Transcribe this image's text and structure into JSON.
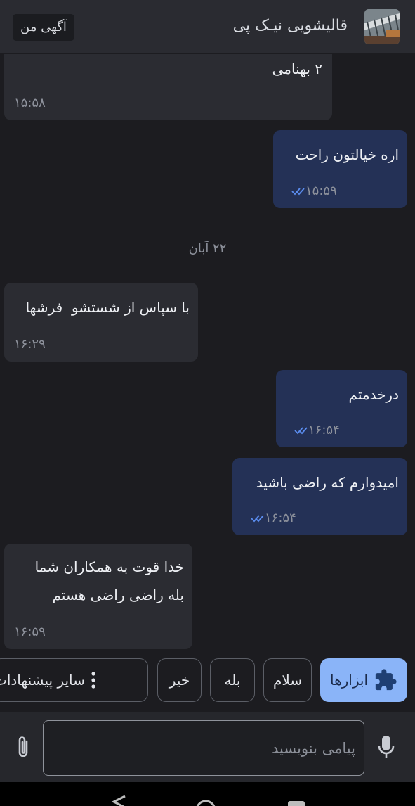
{
  "header": {
    "title": "قالیشویی نیـک پی",
    "my_ad_button": "آگهی من",
    "avatar_icon": "business-photo"
  },
  "messages": [
    {
      "direction": "in",
      "text": "۲ بهنامی",
      "time": "۱۵:۵۸"
    },
    {
      "direction": "out",
      "text": "اره خیالتون راحت",
      "time": "۱۵:۵۹",
      "status": "read"
    },
    {
      "direction": "in",
      "text": "با سپاس از شستشو  فرشها",
      "time": "۱۶:۲۹"
    },
    {
      "direction": "out",
      "text": "درخدمتم",
      "time": "۱۶:۵۴",
      "status": "read"
    },
    {
      "direction": "out",
      "text": "امیدوارم که راضی باشید",
      "time": "۱۶:۵۴",
      "status": "read"
    },
    {
      "direction": "in",
      "lines": [
        "خدا قوت به همکاران شما",
        "بله راضی راضی هستم"
      ],
      "time": "۱۶:۵۹"
    }
  ],
  "date_separator": "۲۲ آبان",
  "suggestions": {
    "tools": "ابزارها",
    "items": [
      "سلام",
      "بله",
      "خیر"
    ],
    "more": "سایر پیشنهادات"
  },
  "composer": {
    "placeholder": "پیامی بنویسید"
  },
  "colors": {
    "background": "#1c1c20",
    "incoming_bubble": "#2b2c32",
    "outgoing_bubble": "#243156",
    "accent": "#8ab4f8",
    "read_ticks": "#5b8def"
  }
}
